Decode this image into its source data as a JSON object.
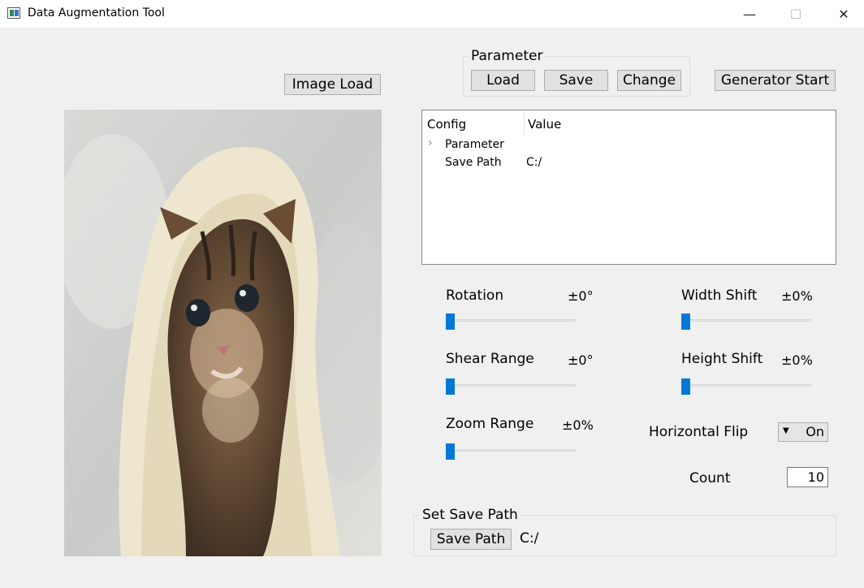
{
  "window": {
    "title": "Data Augmentation Tool",
    "minimize": "—",
    "maximize": "☐",
    "close": "✕"
  },
  "image_load_button": "Image Load",
  "parameter_group": {
    "label": "Parameter",
    "load": "Load",
    "save": "Save",
    "change": "Change"
  },
  "generator_button": "Generator Start",
  "config_tree": {
    "headers": [
      "Config",
      "Value"
    ],
    "rows": [
      {
        "name": "Parameter",
        "value": "",
        "expandable": true
      },
      {
        "name": "Save Path",
        "value": "C:/"
      }
    ]
  },
  "sliders": {
    "rotation": {
      "label": "Rotation",
      "value": "±0°",
      "level": 0
    },
    "shear": {
      "label": "Shear Range",
      "value": "±0°",
      "level": 0
    },
    "zoom": {
      "label": "Zoom Range",
      "value": "±0%",
      "level": 0
    },
    "width_shift": {
      "label": "Width Shift",
      "value": "±0%",
      "level": 0
    },
    "height_shift": {
      "label": "Height Shift",
      "value": "±0%",
      "level": 0
    }
  },
  "horizontal_flip": {
    "label": "Horizontal Flip",
    "value": "On"
  },
  "count": {
    "label": "Count",
    "value": "10"
  },
  "save_path_group": {
    "label": "Set Save Path",
    "button": "Save Path",
    "path": "C:/"
  },
  "colors": {
    "accent": "#0078d7",
    "background": "#f0f0f0"
  },
  "preview": {
    "subject": "kitten-photo"
  }
}
